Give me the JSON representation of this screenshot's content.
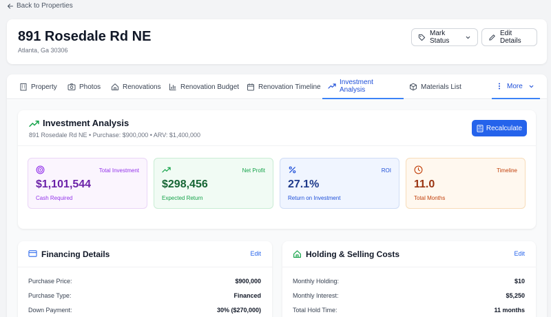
{
  "nav": {
    "back_label": "Back to Properties"
  },
  "property": {
    "title": "891 Rosedale Rd NE",
    "address": "Atlanta, Ga 30306"
  },
  "header_actions": {
    "mark_status_label": "Mark Status",
    "edit_details_label": "Edit Details"
  },
  "tabs": [
    {
      "label": "Property",
      "icon": "building-icon"
    },
    {
      "label": "Photos",
      "icon": "camera-icon"
    },
    {
      "label": "Renovations",
      "icon": "home-icon"
    },
    {
      "label": "Renovation Budget",
      "icon": "bar-chart-icon"
    },
    {
      "label": "Renovation Timeline",
      "icon": "calendar-icon"
    },
    {
      "label": "Investment Analysis",
      "icon": "trending-up-icon",
      "active": true
    },
    {
      "label": "Materials List",
      "icon": "box-icon"
    },
    {
      "label": "More",
      "icon": "more-vertical-icon"
    }
  ],
  "analysis": {
    "title": "Investment Analysis",
    "subtitle": "891 Rosedale Rd NE • Purchase: $900,000 • ARV: $1,400,000",
    "recalculate_label": "Recalculate",
    "metrics": [
      {
        "label": "Total Investment",
        "value": "$1,101,544",
        "sub": "Cash Required",
        "color": "#9333ea",
        "value_color": "#6b21a8",
        "icon": "target-icon"
      },
      {
        "label": "Net Profit",
        "value": "$298,456",
        "sub": "Expected Return",
        "color": "#16a34a",
        "value_color": "#166534",
        "icon": "trending-up-icon"
      },
      {
        "label": "ROI",
        "value": "27.1%",
        "sub": "Return on Investment",
        "color": "#1d4ed8",
        "value_color": "#1e3a8a",
        "icon": "percent-icon"
      },
      {
        "label": "Timeline",
        "value": "11.0",
        "sub": "Total Months",
        "color": "#c2410c",
        "value_color": "#9a3412",
        "icon": "clock-icon"
      }
    ]
  },
  "financing": {
    "title": "Financing Details",
    "edit_label": "Edit",
    "rows": [
      {
        "label": "Purchase Price:",
        "value": "$900,000"
      },
      {
        "label": "Purchase Type:",
        "value": "Financed"
      },
      {
        "label": "Down Payment:",
        "value": "30% ($270,000)"
      }
    ]
  },
  "holding": {
    "title": "Holding & Selling Costs",
    "edit_label": "Edit",
    "rows": [
      {
        "label": "Monthly Holding:",
        "value": "$10"
      },
      {
        "label": "Monthly Interest:",
        "value": "$5,250"
      },
      {
        "label": "Total Hold Time:",
        "value": "11 months"
      }
    ]
  },
  "colors": {
    "accent": "#2563eb",
    "active_tab": "#1d4ed8"
  }
}
